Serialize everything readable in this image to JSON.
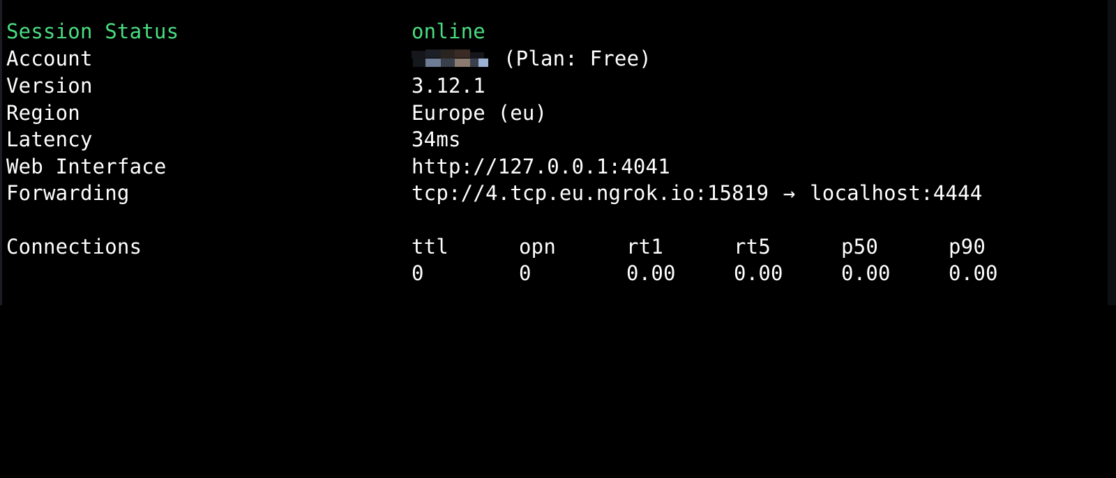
{
  "session_status": {
    "label": "Session Status",
    "value": "online"
  },
  "account": {
    "label": "Account",
    "value": "(Plan: Free)"
  },
  "version": {
    "label": "Version",
    "value": "3.12.1"
  },
  "region": {
    "label": "Region",
    "value": "Europe (eu)"
  },
  "latency": {
    "label": "Latency",
    "value": "34ms"
  },
  "web_interface": {
    "label": "Web Interface",
    "value": "http://127.0.0.1:4041"
  },
  "forwarding": {
    "label": "Forwarding",
    "remote": "tcp://4.tcp.eu.ngrok.io:15819",
    "arrow": "→",
    "local": "localhost:4444"
  },
  "connections": {
    "label": "Connections",
    "headers": [
      "ttl",
      "opn",
      "rt1",
      "rt5",
      "p50",
      "p90"
    ],
    "values": [
      "0",
      "0",
      "0.00",
      "0.00",
      "0.00",
      "0.00"
    ]
  },
  "colors": {
    "background": "#000000",
    "text": "#ffffff",
    "status_green": "#4ade80"
  },
  "icons": {
    "account_name": "redacted-pixelated-blur"
  }
}
